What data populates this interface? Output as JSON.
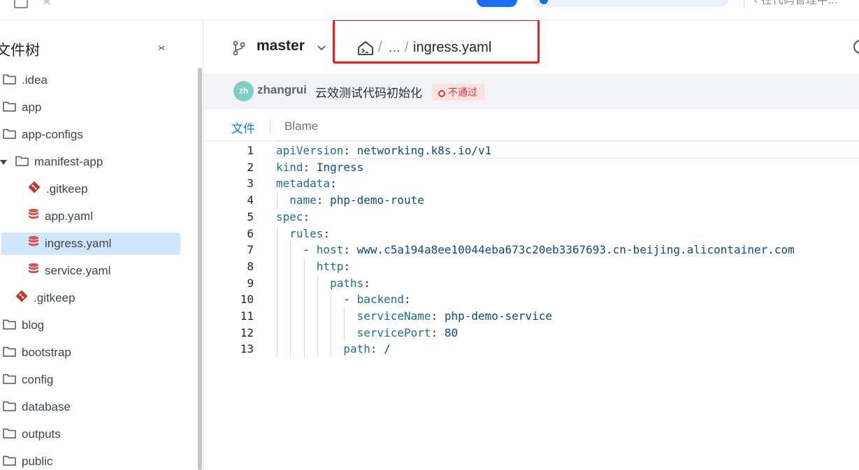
{
  "header": {
    "notice_text": "",
    "right_text": "在代码管理中..."
  },
  "sidebar": {
    "title": "文件树",
    "collapse_label": "›‹",
    "items": [
      {
        "label": ".idea",
        "type": "folder"
      },
      {
        "label": "app",
        "type": "folder"
      },
      {
        "label": "app-configs",
        "type": "folder"
      },
      {
        "label": "manifest-app",
        "type": "folder-open"
      },
      {
        "label": ".gitkeep",
        "type": "git"
      },
      {
        "label": "app.yaml",
        "type": "yaml"
      },
      {
        "label": "ingress.yaml",
        "type": "yaml",
        "selected": true
      },
      {
        "label": "service.yaml",
        "type": "yaml"
      },
      {
        "label": ".gitkeep",
        "type": "git"
      },
      {
        "label": "blog",
        "type": "folder"
      },
      {
        "label": "bootstrap",
        "type": "folder"
      },
      {
        "label": "config",
        "type": "folder"
      },
      {
        "label": "database",
        "type": "folder"
      },
      {
        "label": "outputs",
        "type": "folder"
      },
      {
        "label": "public",
        "type": "folder"
      }
    ]
  },
  "main": {
    "branch": "master",
    "breadcrumb": {
      "sep1": "/",
      "ellipsis": "...",
      "sep2": "/",
      "file": "ingress.yaml"
    },
    "commit": {
      "avatar_initials": "zh",
      "author": "zhangrui",
      "message": "云效测试代码初始化",
      "status": "不通过"
    },
    "tabs": {
      "file": "文件",
      "blame": "Blame"
    },
    "code_lines": [
      {
        "n": "1",
        "key": "apiVersion",
        "val": "networking.k8s.io/v1"
      },
      {
        "n": "2",
        "key": "kind",
        "val": "Ingress"
      },
      {
        "n": "3",
        "key": "metadata",
        "val": ""
      },
      {
        "n": "4",
        "key": "name",
        "val": "php-demo-route"
      },
      {
        "n": "5",
        "key": "spec",
        "val": ""
      },
      {
        "n": "6",
        "key": "rules",
        "val": ""
      },
      {
        "n": "7",
        "key": "host",
        "val": "www.c5a194a8ee10044eba673c20eb3367693.cn-beijing.alicontainer.com"
      },
      {
        "n": "8",
        "key": "http",
        "val": ""
      },
      {
        "n": "9",
        "key": "paths",
        "val": ""
      },
      {
        "n": "10",
        "key": "backend",
        "val": ""
      },
      {
        "n": "11",
        "key": "serviceName",
        "val": "php-demo-service"
      },
      {
        "n": "12",
        "key": "servicePort",
        "val": "80"
      },
      {
        "n": "13",
        "key": "path",
        "val": "/"
      }
    ]
  },
  "colors": {
    "accent": "#1b6ef3",
    "selected_bg": "#cfe6fb",
    "status_fail_bg": "#fde2e2",
    "status_fail_text": "#d33a3a",
    "highlight_box": "#ee1c1c",
    "yaml_key": "#1a6f8f",
    "yaml_value": "#0b4a8a"
  },
  "icons": {
    "folder": "folder-icon",
    "git": "git-icon",
    "yaml": "database-icon",
    "branch": "branch-icon",
    "home": "repo-home-icon"
  }
}
